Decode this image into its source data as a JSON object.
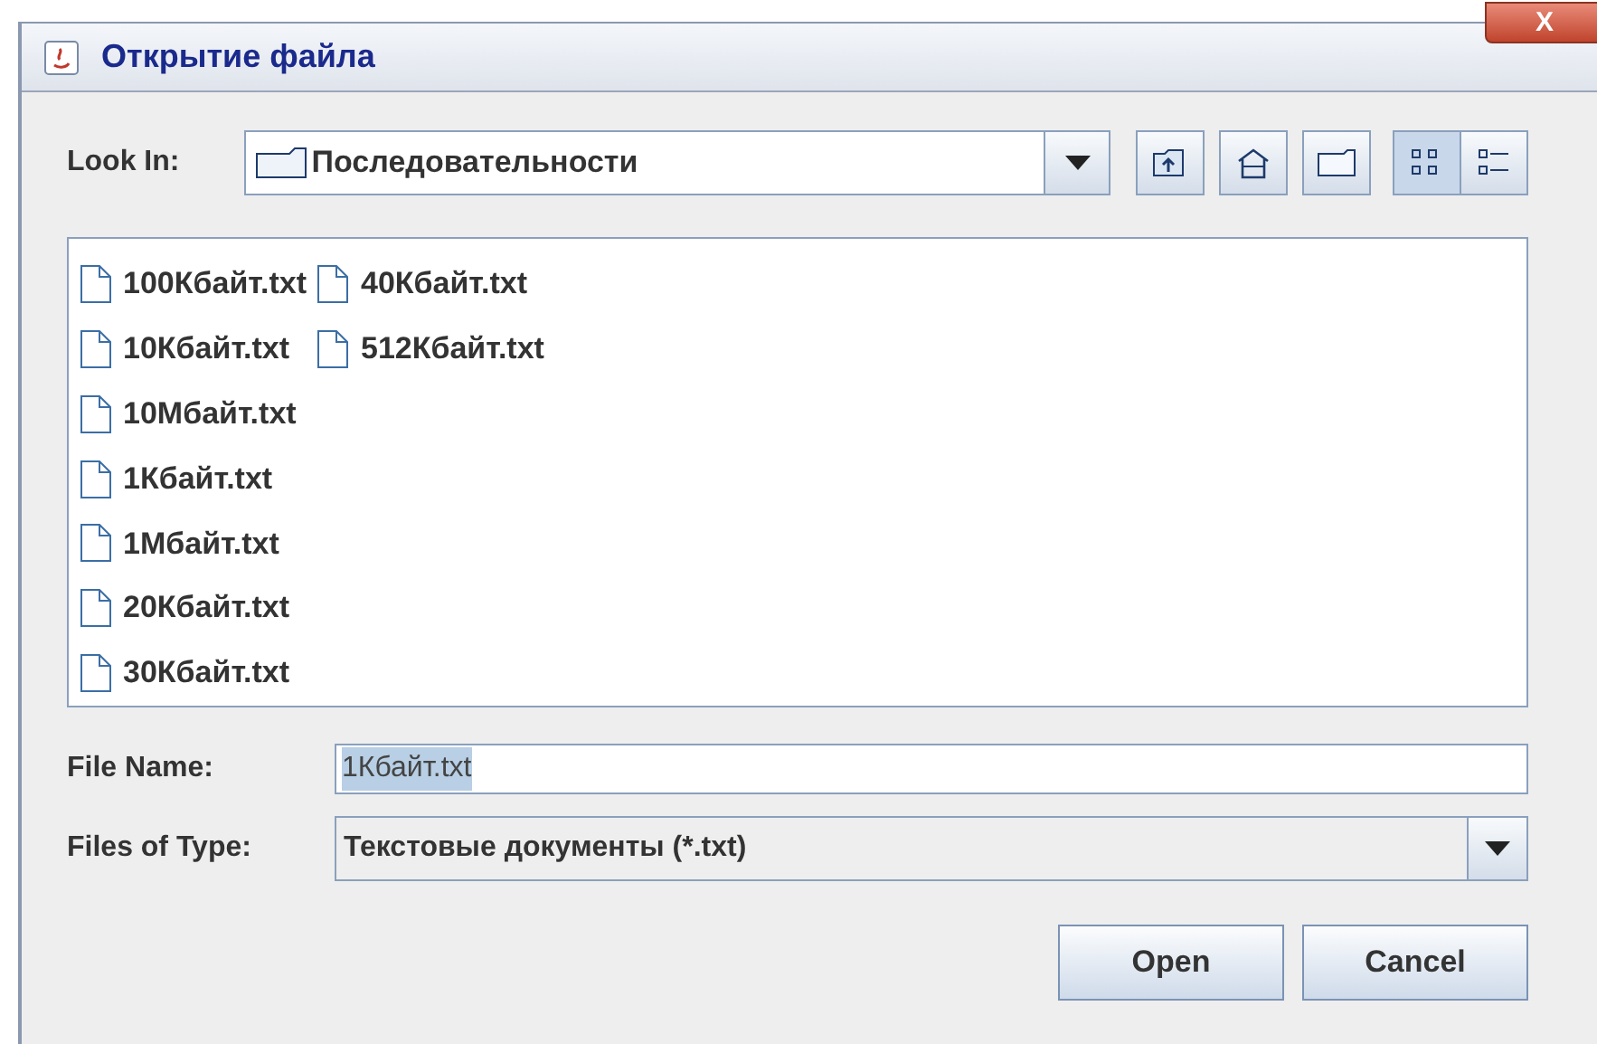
{
  "window": {
    "title": "Открытие файла",
    "close": "X"
  },
  "look_in": {
    "label": "Look In:",
    "value": "Последовательности"
  },
  "toolbar": [
    {
      "kind": "up",
      "selected": false
    },
    {
      "kind": "home",
      "selected": false
    },
    {
      "kind": "new-folder",
      "selected": false
    },
    {
      "kind": "list",
      "selected": true
    },
    {
      "kind": "details",
      "selected": false
    }
  ],
  "files": [
    {
      "name": "100Кбайт.txt"
    },
    {
      "name": "10Кбайт.txt"
    },
    {
      "name": "10Мбайт.txt"
    },
    {
      "name": "1Кбайт.txt"
    },
    {
      "name": "1Мбайт.txt"
    },
    {
      "name": "20Кбайт.txt"
    },
    {
      "name": "30Кбайт.txt"
    },
    {
      "name": "40Кбайт.txt"
    },
    {
      "name": "512Кбайт.txt"
    }
  ],
  "file_name": {
    "label": "File Name:",
    "value": "1Кбайт.txt",
    "text_selected": true
  },
  "files_of_type": {
    "label": "Files of Type:",
    "value": "Текстовые документы (*.txt)"
  },
  "buttons": [
    "Open",
    "Cancel"
  ]
}
